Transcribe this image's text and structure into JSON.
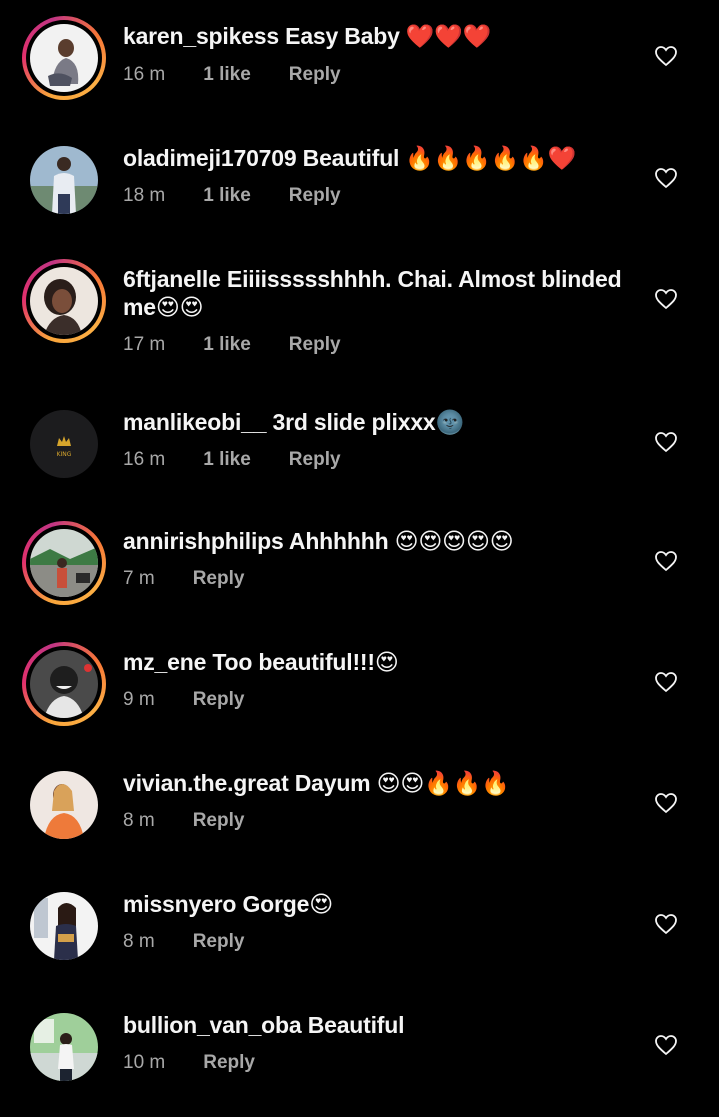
{
  "colors": {
    "background": "#000000",
    "text": "#f5f5f5",
    "meta": "#a8a8a8"
  },
  "comments": [
    {
      "user": "karen_spikess",
      "text": "Easy Baby ❤️❤️❤️",
      "time": "16 m",
      "likes": "1 like",
      "reply": "Reply",
      "story": true,
      "avatar": "woman-sitting"
    },
    {
      "user": "oladimeji170709",
      "text": "Beautiful 🔥🔥🔥🔥🔥❤️",
      "time": "18 m",
      "likes": "1 like",
      "reply": "Reply",
      "story": false,
      "avatar": "man-standing"
    },
    {
      "user": "6ftjanelle",
      "text": "Eiiiissssshhhh. Chai. Almost blinded me😍😍",
      "time": "17 m",
      "likes": "1 like",
      "reply": "Reply",
      "story": true,
      "avatar": "woman-portrait"
    },
    {
      "user": "manlikeobi__",
      "text": "3rd slide plixxx🌚",
      "time": "16 m",
      "likes": "1 like",
      "reply": "Reply",
      "story": false,
      "avatar": "king-logo"
    },
    {
      "user": "annirishphilips",
      "text": "Ahhhhhh 😍😍😍😍😍",
      "time": "7 m",
      "likes": "",
      "reply": "Reply",
      "story": true,
      "avatar": "outdoor-street"
    },
    {
      "user": "mz_ene",
      "text": "Too beautiful!!!😍",
      "time": "9 m",
      "likes": "",
      "reply": "Reply",
      "story": true,
      "avatar": "smiling-woman-bw"
    },
    {
      "user": "vivian.the.great",
      "text": "Dayum 😍😍🔥🔥🔥",
      "time": "8 m",
      "likes": "",
      "reply": "Reply",
      "story": false,
      "avatar": "woman-orange-top"
    },
    {
      "user": "missnyero",
      "text": "Gorge😍",
      "time": "8 m",
      "likes": "",
      "reply": "Reply",
      "story": false,
      "avatar": "woman-dress"
    },
    {
      "user": "bullion_van_oba",
      "text": "Beautiful",
      "time": "10 m",
      "likes": "",
      "reply": "Reply",
      "story": false,
      "avatar": "man-garden"
    }
  ]
}
